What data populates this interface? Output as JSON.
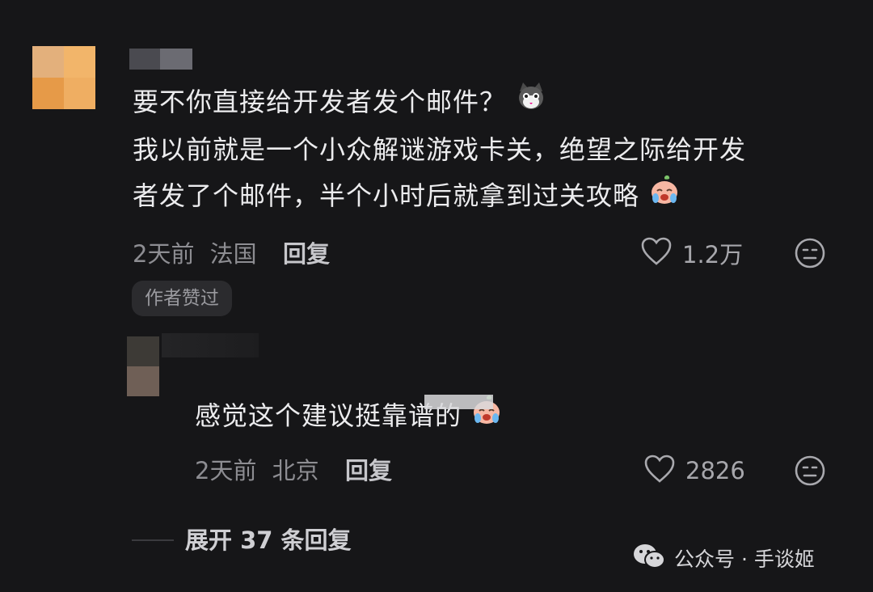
{
  "comment": {
    "line1": "要不你直接给开发者发个邮件？",
    "line2": "我以前就是一个小众解谜游戏卡关，绝望之际给开发",
    "line3": "者发了个邮件，半个小时后就拿到过关攻略",
    "meta_time": "2天前",
    "meta_location": "法国",
    "reply_label": "回复",
    "like_count": "1.2万",
    "badge": "作者赞过"
  },
  "reply": {
    "text": "感觉这个建议挺靠谱的",
    "meta_time": "2天前",
    "meta_location": "北京",
    "reply_label": "回复",
    "like_count": "2826"
  },
  "expand": {
    "label": "展开 37 条回复"
  },
  "watermark": {
    "label": "公众号 · 手谈姬"
  },
  "icons": {
    "like": "heart-outline-icon",
    "reaction": "neutral-face-icon",
    "emoji_cat": "cat-emoji-icon",
    "emoji_cry": "crying-face-emoji-icon",
    "wechat": "wechat-icon"
  }
}
